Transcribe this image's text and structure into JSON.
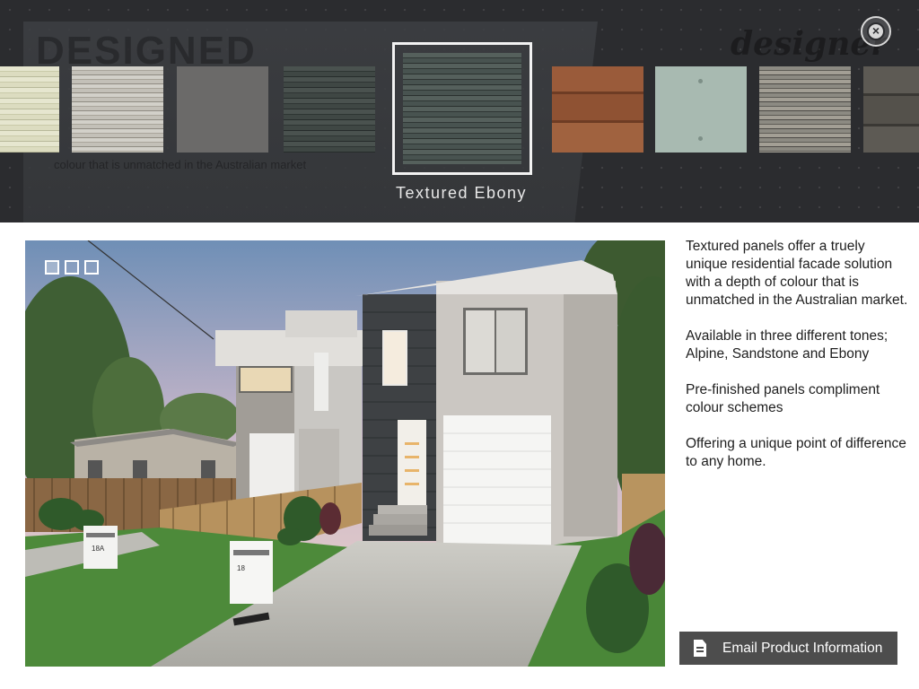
{
  "carousel": {
    "selected_name": "Textured Ebony",
    "watermark_title": "DESIGNED",
    "watermark_subtitle": "colour that is unmatched in the Australian market",
    "brand_watermark": "designer",
    "swatches": [
      {
        "icon": "cream-stacked-swatch"
      },
      {
        "icon": "grey-striped-swatch"
      },
      {
        "icon": "flat-grey-swatch"
      },
      {
        "icon": "dark-stone-swatch"
      },
      {
        "icon": "textured-ebony-swatch",
        "selected": true
      },
      {
        "icon": "timber-brown-swatch"
      },
      {
        "icon": "sage-panel-swatch"
      },
      {
        "icon": "mixed-stone-swatch"
      },
      {
        "icon": "dark-timber-swatch"
      }
    ]
  },
  "close_icon": "close-icon",
  "gallery": {
    "thumb_count": 3,
    "active_thumb": 1
  },
  "description": {
    "para1": "Textured panels offer a truely unique residential facade solution with a depth of colour that is unmatched in the Australian market.",
    "para2": "Available in three different tones; Alpine, Sandstone and Ebony",
    "para3": "Pre-finished panels compliment colour schemes",
    "para4": "Offering a unique point of difference to any home."
  },
  "email_button": {
    "label": "Email Product Information",
    "icon": "document-icon"
  },
  "photo": {
    "mailbox_1": "18A",
    "mailbox_2": "18"
  },
  "colors": {
    "top_bar": "#2b2c2f",
    "button": "#4d4d4d"
  }
}
